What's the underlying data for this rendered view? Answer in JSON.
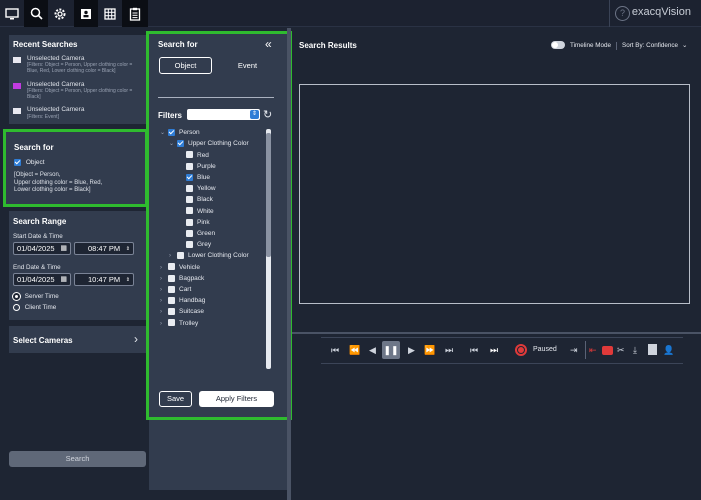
{
  "topbar": {
    "brand": "exacqVision",
    "help": "?",
    "icons": [
      "monitor-icon",
      "search-icon",
      "gear-icon",
      "person-card-icon",
      "grid-icon",
      "clipboard-icon"
    ]
  },
  "recent": {
    "title": "Recent Searches",
    "items": [
      {
        "name": "Unselected Camera",
        "detail": "[Filters: Object = Person, Upper clothing color = Blue, Red, Lower clothing color = Black]",
        "color": "#e8e8f0"
      },
      {
        "name": "Unselected Camera",
        "detail": "[Filters: Object = Person, Upper clothing color = Black]",
        "color": "#c13be0"
      },
      {
        "name": "Unselected Camera",
        "detail": "[Filters: Event]",
        "color": "#e8e8f0"
      }
    ]
  },
  "searchfor_left": {
    "title": "Search for",
    "object_label": "Object",
    "summary": "[Object = Person,\nUpper clothing color = Blue, Red,\nLower clothing color = Black]"
  },
  "range": {
    "title": "Search Range",
    "start_label": "Start Date & Time",
    "start_date": "01/04/2025",
    "start_time": "08:47 PM",
    "end_label": "End Date & Time",
    "end_date": "01/04/2025",
    "end_time": "10:47 PM",
    "server": "Server Time",
    "client": "Client Time"
  },
  "cameras": {
    "label": "Select Cameras",
    "chevron": "›"
  },
  "search_button": "Search",
  "mid": {
    "title": "Search for",
    "collapse": "«",
    "tab_object": "Object",
    "tab_event": "Event",
    "filters_label": "Filters",
    "save": "Save",
    "apply": "Apply Filters"
  },
  "tree": [
    {
      "label": "Person",
      "level": 0,
      "caret": "⌄",
      "checked": true
    },
    {
      "label": "Upper Clothing Color",
      "level": 1,
      "caret": "⌄",
      "checked": true
    },
    {
      "label": "Red",
      "level": 2,
      "caret": "",
      "checked": false
    },
    {
      "label": "Purple",
      "level": 2,
      "caret": "",
      "checked": false
    },
    {
      "label": "Blue",
      "level": 2,
      "caret": "",
      "checked": true
    },
    {
      "label": "Yellow",
      "level": 2,
      "caret": "",
      "checked": false
    },
    {
      "label": "Black",
      "level": 2,
      "caret": "",
      "checked": false
    },
    {
      "label": "White",
      "level": 2,
      "caret": "",
      "checked": false
    },
    {
      "label": "Pink",
      "level": 2,
      "caret": "",
      "checked": false
    },
    {
      "label": "Green",
      "level": 2,
      "caret": "",
      "checked": false
    },
    {
      "label": "Grey",
      "level": 2,
      "caret": "",
      "checked": false
    },
    {
      "label": "Lower Clothing Color",
      "level": 1,
      "caret": "›",
      "checked": false
    },
    {
      "label": "Vehicle",
      "level": 0,
      "caret": "›",
      "checked": false
    },
    {
      "label": "Bagpack",
      "level": 0,
      "caret": "›",
      "checked": false
    },
    {
      "label": "Cart",
      "level": 0,
      "caret": "›",
      "checked": false
    },
    {
      "label": "Handbag",
      "level": 0,
      "caret": "›",
      "checked": false
    },
    {
      "label": "Suitcase",
      "level": 0,
      "caret": "›",
      "checked": false
    },
    {
      "label": "Trolley",
      "level": 0,
      "caret": "›",
      "checked": false
    }
  ],
  "results": {
    "title": "Search Results",
    "timeline": "Timeline Mode",
    "sort": "Sort By: Confidence"
  },
  "playback": {
    "status": "Paused",
    "buttons": [
      "skip-start-icon",
      "fast-rewind-icon",
      "step-back-icon",
      "pause-icon",
      "play-icon",
      "fast-forward-icon",
      "skip-end-icon",
      "prev-segment-icon",
      "next-segment-icon"
    ]
  },
  "colors": {
    "accent_green": "#2fbb2f",
    "checkbox_blue": "#2f7dd6",
    "record_red": "#e03a3a"
  }
}
